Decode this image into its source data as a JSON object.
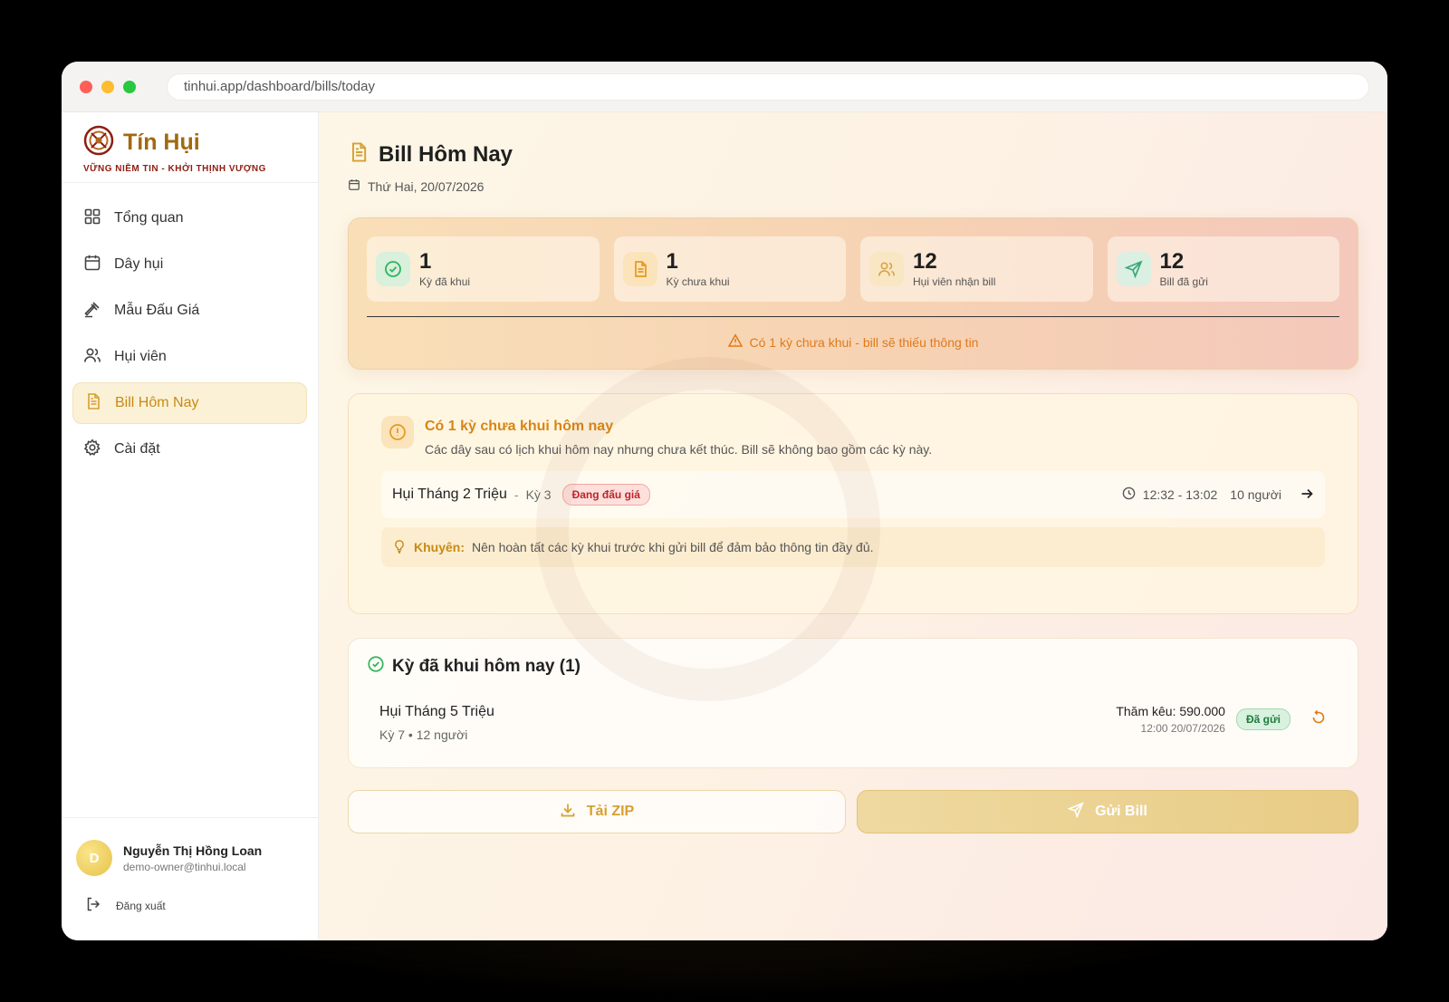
{
  "browser": {
    "url": "tinhui.app/dashboard/bills/today"
  },
  "brand": {
    "name": "Tín Hụi",
    "tagline": "VỮNG NIỀM TIN - KHỞI THỊNH VƯỢNG"
  },
  "sidebar": {
    "items": [
      {
        "label": "Tổng quan",
        "icon": "grid-icon"
      },
      {
        "label": "Dây hụi",
        "icon": "calendar-icon"
      },
      {
        "label": "Mẫu Đấu Giá",
        "icon": "gavel-icon"
      },
      {
        "label": "Hụi viên",
        "icon": "users-icon"
      },
      {
        "label": "Bill Hôm Nay",
        "icon": "file-text-icon",
        "active": true
      },
      {
        "label": "Cài đặt",
        "icon": "gear-icon"
      }
    ]
  },
  "user": {
    "avatar_initial": "D",
    "name": "Nguyễn Thị Hồng Loan",
    "email": "demo-owner@tinhui.local",
    "logout_label": "Đăng xuất"
  },
  "page": {
    "title": "Bill Hôm Nay",
    "date": "Thứ Hai, 20/07/2026"
  },
  "stats": [
    {
      "value": "1",
      "label": "Kỳ đã khui",
      "icon": "check-circle-icon",
      "color": "#2fb55b"
    },
    {
      "value": "1",
      "label": "Kỳ chưa khui",
      "icon": "file-text-icon",
      "color": "#e59a1c"
    },
    {
      "value": "12",
      "label": "Hụi viên nhận bill",
      "icon": "users-icon",
      "color": "#d9a24a"
    },
    {
      "value": "12",
      "label": "Bill đã gửi",
      "icon": "send-icon",
      "color": "#3aa878"
    }
  ],
  "stats_warning": "Có 1 kỳ chưa khui - bill sẽ thiếu thông tin",
  "pending": {
    "title": "Có 1 kỳ chưa khui hôm nay",
    "subtitle": "Các dây sau có lịch khui hôm nay nhưng chưa kết thúc. Bill sẽ không bao gồm các kỳ này.",
    "rows": [
      {
        "name": "Hụi Tháng 2 Triệu",
        "separator": "-",
        "ky": "Kỳ 3",
        "status": "Đang đấu giá",
        "time": "12:32 - 13:02",
        "members": "10 người"
      }
    ],
    "tip_label": "Khuyên:",
    "tip_text": "Nên hoàn tất các kỳ khui trước khi gửi bill để đảm bảo thông tin đầy đủ."
  },
  "done": {
    "title": "Kỳ đã khui hôm nay (1)",
    "rows": [
      {
        "name": "Hụi Tháng 5 Triệu",
        "meta": "Kỳ 7 • 12 người",
        "amount": "Thăm kêu: 590.000",
        "time": "12:00 20/07/2026",
        "status": "Đã gửi"
      }
    ]
  },
  "actions": {
    "zip_label": "Tải ZIP",
    "send_label": "Gửi Bill"
  },
  "colors": {
    "accent": "#c88a14",
    "brand": "#a06a12",
    "warning": "#e07a1a",
    "danger": "#c0232a",
    "success": "#2fb55b"
  }
}
